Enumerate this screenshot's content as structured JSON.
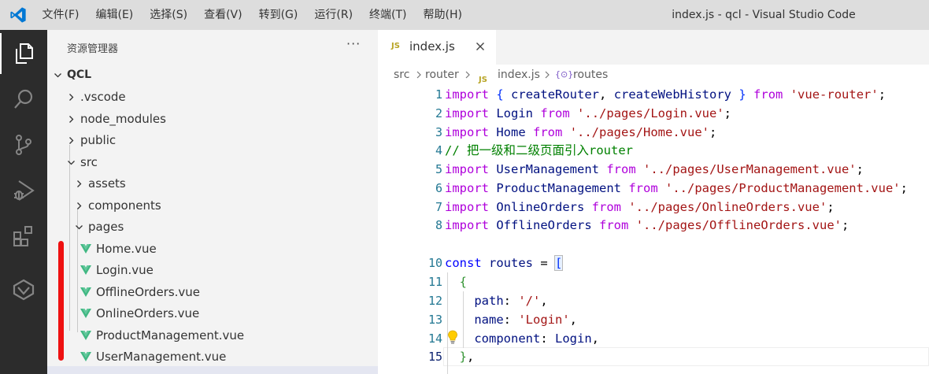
{
  "titlebar": {
    "menu": [
      "文件(F)",
      "编辑(E)",
      "选择(S)",
      "查看(V)",
      "转到(G)",
      "运行(R)",
      "终端(T)",
      "帮助(H)"
    ],
    "title": "index.js - qcl - Visual Studio Code"
  },
  "activity": [
    "explorer-icon",
    "search-icon",
    "source-control-icon",
    "run-debug-icon",
    "extensions-icon",
    "remote-icon"
  ],
  "sidebar": {
    "header": "资源管理器",
    "more": "···",
    "tree": {
      "root": "QCL",
      "vscode": ".vscode",
      "node_modules": "node_modules",
      "public": "public",
      "src": "src",
      "assets": "assets",
      "components": "components",
      "pages": "pages",
      "files": [
        "Home.vue",
        "Login.vue",
        "OfflineOrders.vue",
        "OnlineOrders.vue",
        "ProductManagement.vue",
        "UserManagement.vue"
      ]
    }
  },
  "editor": {
    "tab": {
      "badge": "JS",
      "label": "index.js"
    },
    "breadcrumb": {
      "src": "src",
      "router": "router",
      "badge": "JS",
      "file": "index.js",
      "symbol_icon": "{⊙}",
      "symbol": "routes"
    },
    "line_numbers": [
      "1",
      "2",
      "3",
      "4",
      "5",
      "6",
      "7",
      "8",
      "10",
      "11",
      "12",
      "13",
      "14",
      "15"
    ]
  },
  "colors": {
    "keyword": "#0000ff",
    "import": "#af00db",
    "string": "#a31515",
    "comment": "#008000",
    "variable": "#001080",
    "vue_green": "#41b883",
    "js_yellow": "#b8a425",
    "highlight_red": "#ee1111"
  }
}
